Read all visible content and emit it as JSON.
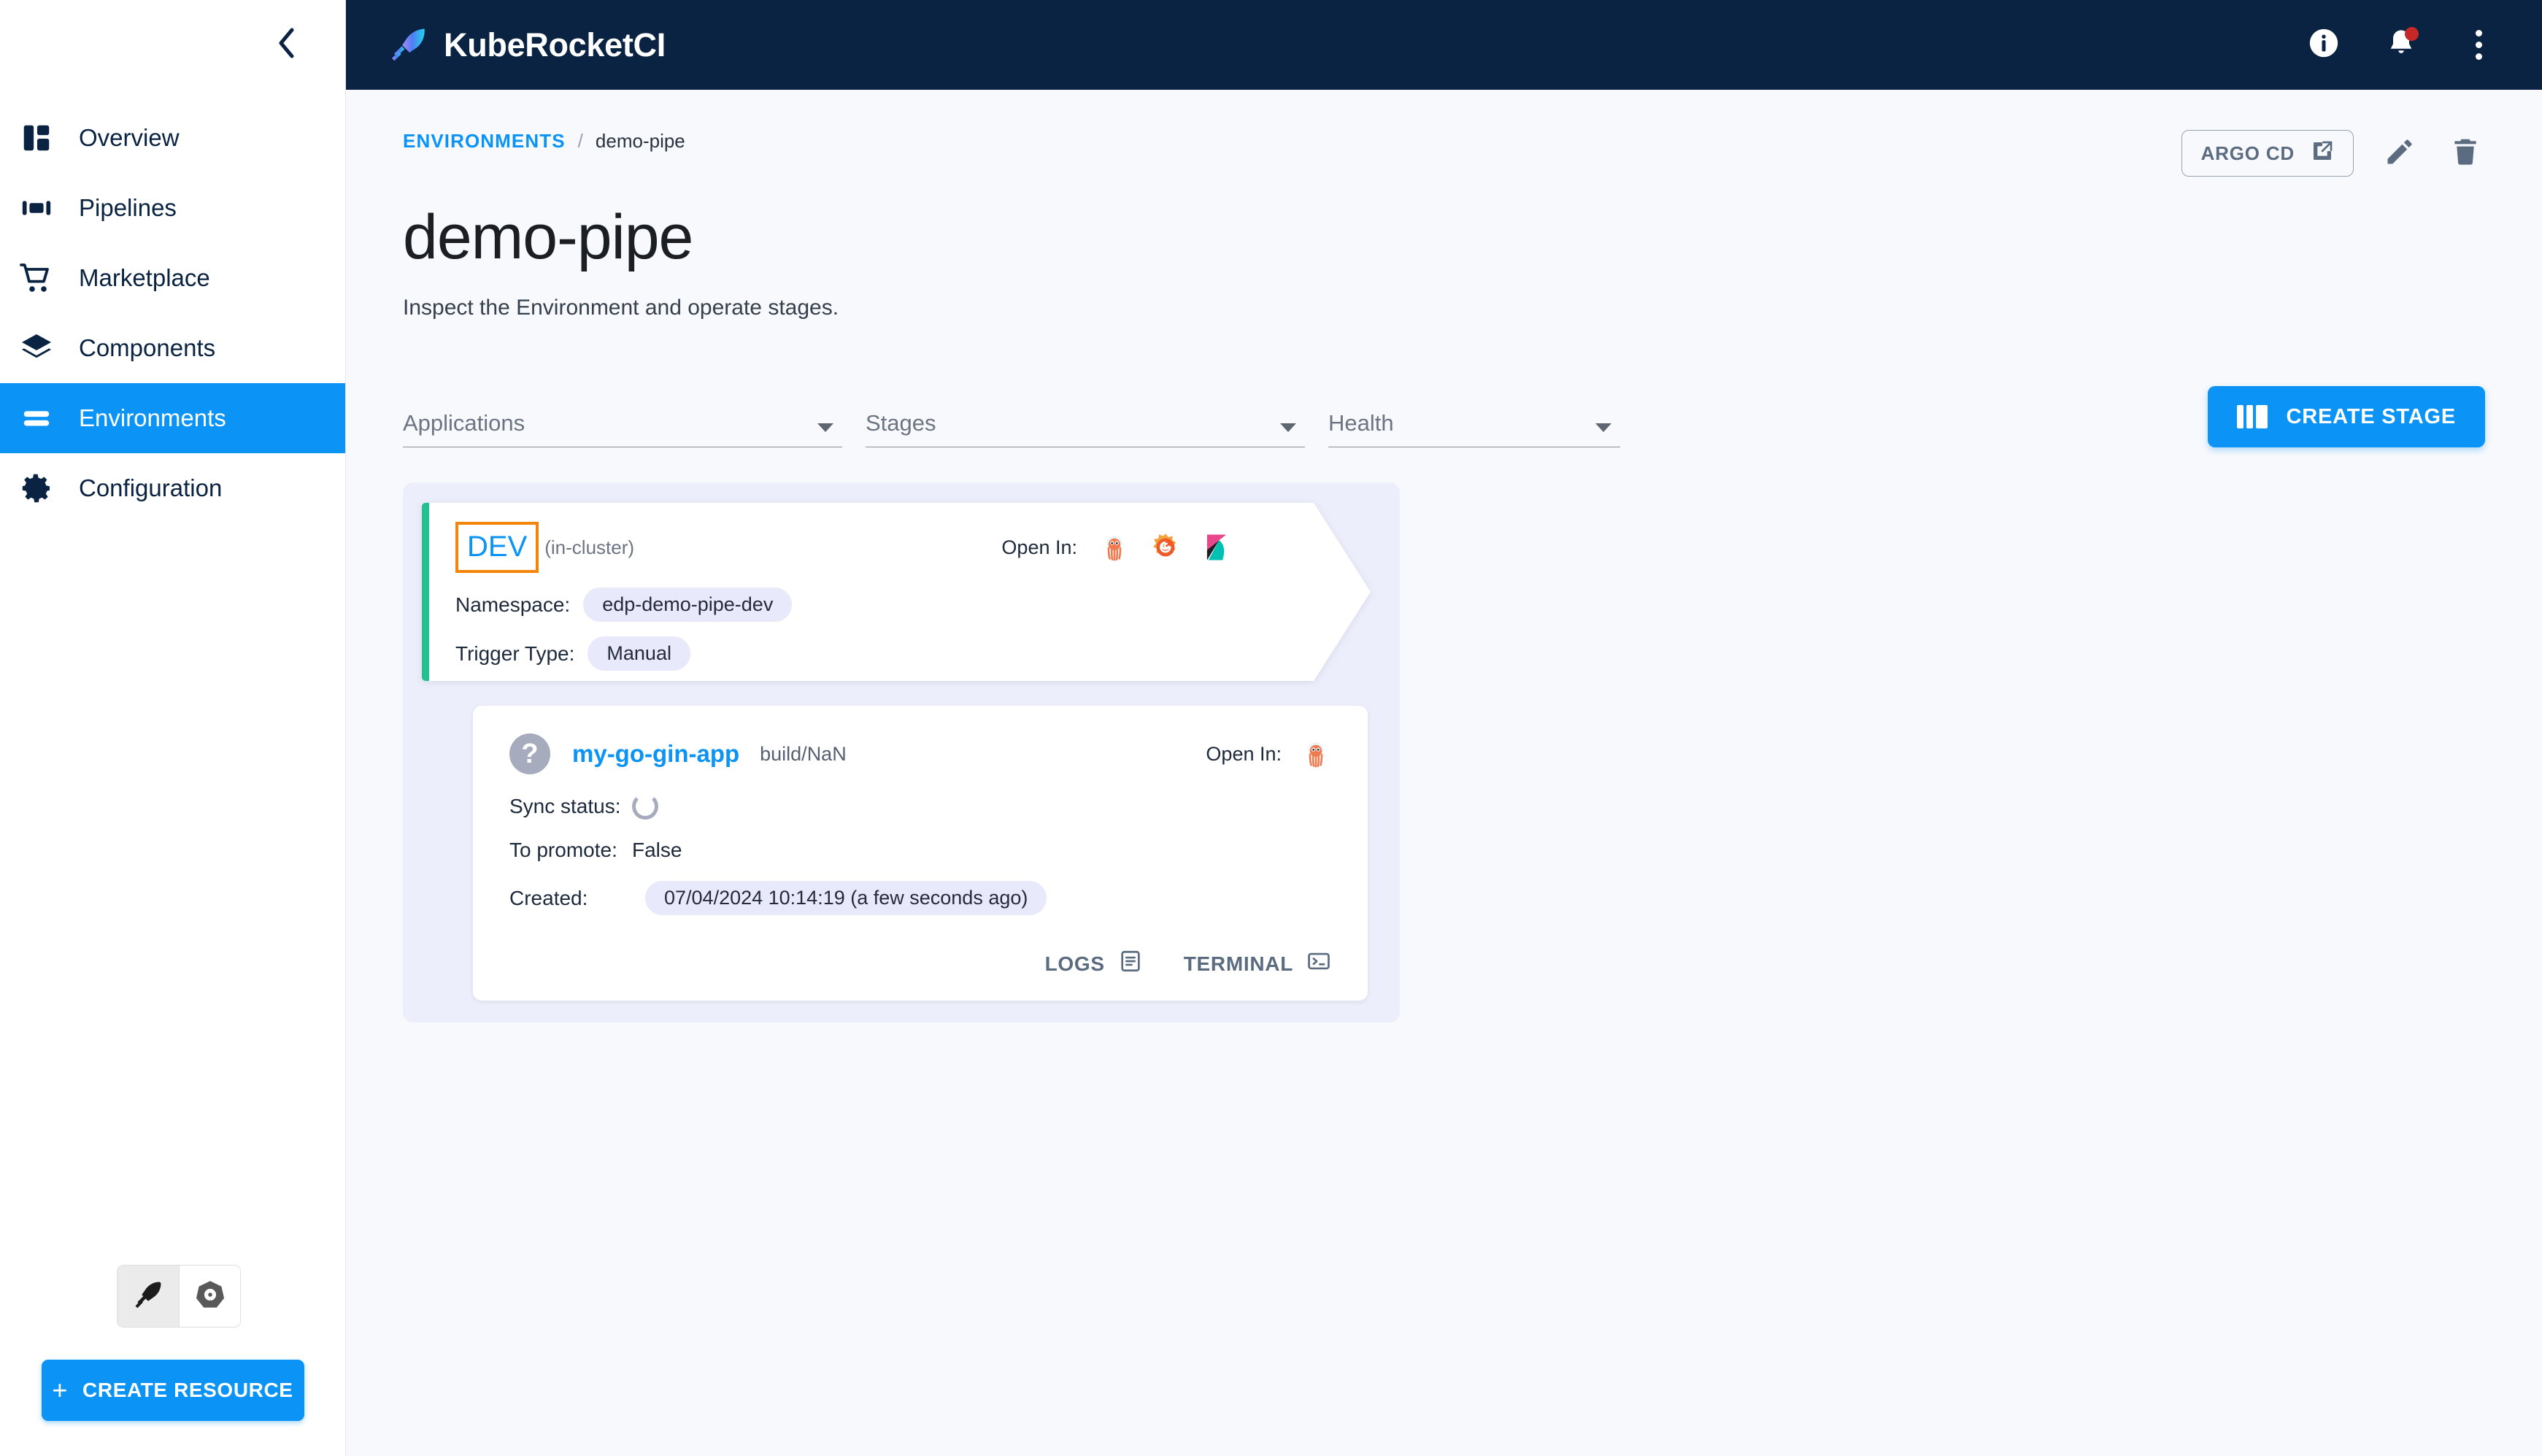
{
  "header": {
    "brand_title": "KubeRocketCI",
    "logo_icon": "rocket-logo-icon",
    "info_icon": "info-icon",
    "notifications_icon": "bell-icon",
    "menu_icon": "kebab-menu-icon"
  },
  "sidebar": {
    "collapse_icon": "chevron-left-icon",
    "items": [
      {
        "label": "Overview",
        "icon": "dashboard-icon",
        "active": false
      },
      {
        "label": "Pipelines",
        "icon": "pipelines-icon",
        "active": false
      },
      {
        "label": "Marketplace",
        "icon": "cart-icon",
        "active": false
      },
      {
        "label": "Components",
        "icon": "layers-icon",
        "active": false
      },
      {
        "label": "Environments",
        "icon": "environments-icon",
        "active": true
      },
      {
        "label": "Configuration",
        "icon": "gear-icon",
        "active": false
      }
    ],
    "view_toggles": [
      {
        "icon": "rocket-icon",
        "selected": true
      },
      {
        "icon": "kubernetes-icon",
        "selected": false
      }
    ],
    "create_resource_label": "CREATE RESOURCE",
    "create_resource_icon": "plus-icon"
  },
  "breadcrumb": {
    "root_label": "ENVIRONMENTS",
    "separator": "/",
    "current_label": "demo-pipe"
  },
  "page": {
    "title": "demo-pipe",
    "subtitle": "Inspect the Environment and operate stages."
  },
  "page_actions": {
    "argo_cd_label": "ARGO CD",
    "argo_cd_icon": "external-link-icon",
    "edit_icon": "pencil-icon",
    "delete_icon": "trash-icon"
  },
  "filters": {
    "applications_label": "Applications",
    "stages_label": "Stages",
    "health_label": "Health",
    "caret_icon": "chevron-down-icon",
    "create_stage_label": "CREATE STAGE",
    "create_stage_icon": "columns-icon"
  },
  "stage": {
    "name": "DEV",
    "name_highlighted": true,
    "highlight_color": "#f4850a",
    "cluster": "(in-cluster)",
    "accent_color": "#24c08e",
    "open_in_label": "Open In:",
    "open_in_icons": [
      "argocd-icon",
      "grafana-icon",
      "kibana-icon"
    ],
    "namespace_key": "Namespace:",
    "namespace_value": "edp-demo-pipe-dev",
    "trigger_key": "Trigger Type:",
    "trigger_value": "Manual"
  },
  "application": {
    "status_icon": "unknown-status-icon",
    "status_glyph": "?",
    "name": "my-go-gin-app",
    "build": "build/NaN",
    "open_in_label": "Open In:",
    "open_in_icons": [
      "argocd-icon"
    ],
    "sync_status_key": "Sync status:",
    "sync_status_icon": "loading-spinner-icon",
    "to_promote_key": "To promote:",
    "to_promote_value": "False",
    "created_key": "Created:",
    "created_value": "07/04/2024 10:14:19 (a few seconds ago)",
    "logs_label": "LOGS",
    "logs_icon": "document-icon",
    "terminal_label": "TERMINAL",
    "terminal_icon": "terminal-icon"
  },
  "colors": {
    "header_bg": "#0a2342",
    "accent_blue": "#0b93f6",
    "stage_accent_green": "#24c08e",
    "highlight_orange": "#f4850a",
    "pipeline_bg": "#edeefb",
    "chip_bg": "#e8e9fb"
  }
}
